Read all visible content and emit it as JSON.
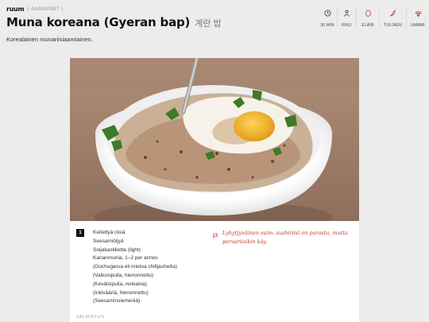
{
  "site": {
    "logo": "ruum",
    "breadcrumb": "( AAMIAISET )"
  },
  "recipe": {
    "title": "Muna koreana (Gyeran bap)",
    "korean_title": "계란 밥",
    "subtitle": "Korealainen munariisiaamiainen."
  },
  "meta": [
    {
      "icon": "clock-icon",
      "label": "30 MIN"
    },
    {
      "icon": "person-icon",
      "label": "RIKU"
    },
    {
      "icon": "egg-icon",
      "label": "ELÄIN"
    },
    {
      "icon": "chili-icon",
      "label": "TULINEN"
    },
    {
      "icon": "mushroom-icon",
      "label": "UMAMI"
    }
  ],
  "photo": {
    "icon": "food-photo-icon"
  },
  "ingredients": {
    "step_number": "1",
    "items": [
      "Keitettyä riisiä",
      "Seesamiöljyä",
      "Soijakastiketta (light)",
      "Kananmunia, 1–2 per annos",
      "(Gochugarua eli mietoa chilijauhetta)",
      "(Valkosipulia, hienonnettu)",
      "(Kevätsipulia, renkaina)",
      "(Inkivääriä, hienonnettu)",
      "(Seesaminsiemeniä)"
    ],
    "tip": "Lyhytjyväinen esim. sushiriisi on parasta, mutta perusriisikin käy.",
    "tip_icon": "flag-icon"
  },
  "method": {
    "label": "VALMISTUS"
  },
  "colors": {
    "accent": "#c0392b",
    "background": "#ececec"
  }
}
